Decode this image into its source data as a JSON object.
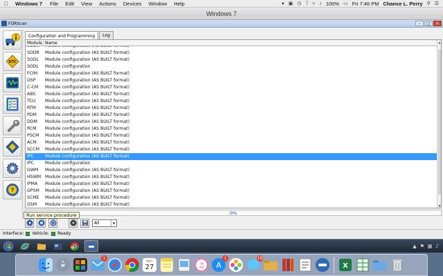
{
  "mac_menubar": {
    "app_name": "Windows 7",
    "menus": [
      "File",
      "Edit",
      "View",
      "Actions",
      "Devices",
      "Window",
      "Help"
    ],
    "battery": "100%",
    "clock": "Fri 7:46 PM",
    "user": "Chance L. Perry"
  },
  "vm_window": {
    "title": "Windows 7"
  },
  "app_window": {
    "title": "FORScan"
  },
  "tabs": [
    {
      "label": "Configuration and Programming",
      "active": true
    },
    {
      "label": "Log",
      "active": false
    }
  ],
  "table": {
    "columns": [
      "Module",
      "Name"
    ],
    "rows": [
      {
        "module": "SODR",
        "name": "Module configuration (AS BUILT format)",
        "cut": true
      },
      {
        "module": "SODR",
        "name": "Module configuration (AS BUILT format)"
      },
      {
        "module": "SODL",
        "name": "Module configuration (AS BUILT format)"
      },
      {
        "module": "SODL",
        "name": "Module configuration"
      },
      {
        "module": "FCIM",
        "name": "Module configuration (AS BUILT format)"
      },
      {
        "module": "DSP",
        "name": "Module configuration (AS BUILT format)"
      },
      {
        "module": "C-CM",
        "name": "Module configuration (AS BUILT format)"
      },
      {
        "module": "ABS",
        "name": "Module configuration (AS BUILT format)"
      },
      {
        "module": "TCU",
        "name": "Module configuration (AS BUILT format)"
      },
      {
        "module": "RTM",
        "name": "Module configuration (AS BUILT format)"
      },
      {
        "module": "PDM",
        "name": "Module configuration (AS BUILT format)"
      },
      {
        "module": "DDM",
        "name": "Module configuration (AS BUILT format)"
      },
      {
        "module": "RCM",
        "name": "Module configuration (AS BUILT format)"
      },
      {
        "module": "PSCM",
        "name": "Module configuration (AS BUILT format)"
      },
      {
        "module": "ACM",
        "name": "Module configuration (AS BUILT format)"
      },
      {
        "module": "SCCM",
        "name": "Module configuration (AS BUILT format)"
      },
      {
        "module": "IPC",
        "name": "Module configuration (AS BUILT format)",
        "selected": true
      },
      {
        "module": "IPC",
        "name": "Module configuration"
      },
      {
        "module": "GWM",
        "name": "Module configuration (AS BUILT format)"
      },
      {
        "module": "HSWM",
        "name": "Module configuration (AS BUILT format)"
      },
      {
        "module": "IPMA",
        "name": "Module configuration (AS BUILT format)"
      },
      {
        "module": "GPSM",
        "name": "Module configuration (AS BUILT format)"
      },
      {
        "module": "SCME",
        "name": "Module configuration (AS BUILT format)"
      },
      {
        "module": "DSM",
        "name": "Module configuration (AS BUILT format)"
      }
    ]
  },
  "progress": {
    "text": "0%",
    "value": 0
  },
  "tooltip": "Run service procedure",
  "filter": {
    "selected": "All"
  },
  "status": {
    "interface_label": "Interface:",
    "vehicle_label": "Vehicle:",
    "ready": "Ready"
  },
  "calendar": {
    "month": "MAY",
    "day": "27"
  },
  "dock_badges": {
    "mail": "1",
    "appstore": "1",
    "messages": "18"
  },
  "colors": {
    "selection": "#3399ff",
    "progress_text": "#1a3fa0",
    "led": "#2e9e3f"
  }
}
